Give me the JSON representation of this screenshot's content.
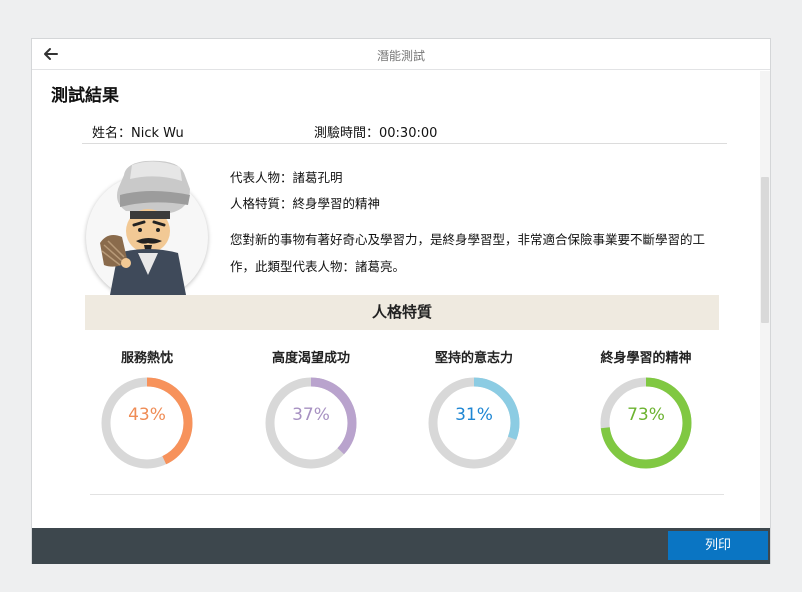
{
  "window": {
    "title": "潛能測試"
  },
  "result": {
    "heading": "測試結果"
  },
  "info": {
    "name": "姓名：Nick Wu",
    "time": "測驗時間：00:30:00"
  },
  "character": {
    "representative": "代表人物：諸葛孔明",
    "trait": "人格特質：終身學習的精神",
    "description": "您對新的事物有著好奇心及學習力，是終身學習型，非常適合保險事業要不斷學習的工作，此類型代表人物：諸葛亮。"
  },
  "traits": {
    "header": "人格特質",
    "items": [
      {
        "label": "服務熱忱",
        "percent_text": "43%",
        "value": 43,
        "color": "#f7925b",
        "text_color": "#ef8c55"
      },
      {
        "label": "高度渴望成功",
        "percent_text": "37%",
        "value": 37,
        "color": "#b9a3cd",
        "text_color": "#a791c2"
      },
      {
        "label": "堅持的意志力",
        "percent_text": "31%",
        "value": 31,
        "color": "#8ccce3",
        "text_color": "#1e86d3"
      },
      {
        "label": "終身學習的精神",
        "percent_text": "73%",
        "value": 73,
        "color": "#80c842",
        "text_color": "#6cb330"
      }
    ]
  },
  "footer": {
    "print_label": "列印"
  },
  "colors": {
    "track": "#d8d8d8",
    "footer_bg": "#3d474d",
    "button_bg": "#0a75c3",
    "header_bg": "#efeae0"
  },
  "icons": {
    "back": "arrow-left-icon",
    "avatar": "zhuge-liang-avatar"
  }
}
